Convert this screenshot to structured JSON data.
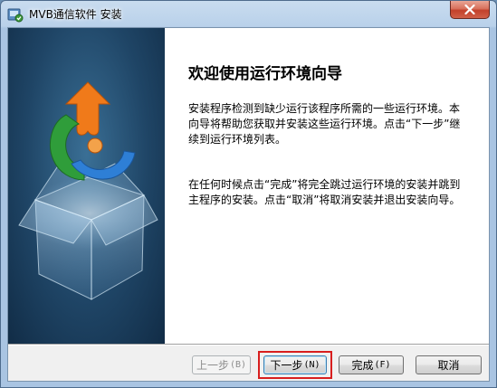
{
  "window": {
    "title": "MVB通信软件 安装",
    "close_label": "✕"
  },
  "wizard": {
    "heading": "欢迎使用运行环境向导",
    "paragraph1": "安装程序检测到缺少运行该程序所需的一些运行环境。本向导将帮助您获取并安装这些运行环境。点击“下一步”继续到运行环境列表。",
    "paragraph2": "在任何时候点击“完成”将完全跳过运行环境的安装并跳到主程序的安装。点击“取消”将取消安装并退出安装向导。"
  },
  "buttons": {
    "back": "上一步",
    "back_key": "(B)",
    "next": "下一步",
    "next_key": "(N)",
    "finish": "完成",
    "finish_key": "(F)",
    "cancel": "取消"
  },
  "colors": {
    "highlight": "#d81e1e",
    "panel_dark": "#1f4566"
  }
}
